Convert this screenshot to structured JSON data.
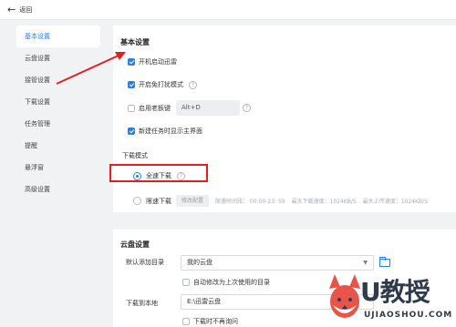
{
  "topbar": {
    "back_label": "返回"
  },
  "sidebar": {
    "items": [
      {
        "label": "基本设置",
        "active": true
      },
      {
        "label": "云盘设置",
        "active": false
      },
      {
        "label": "接管设置",
        "active": false
      },
      {
        "label": "下载设置",
        "active": false
      },
      {
        "label": "任务管理",
        "active": false
      },
      {
        "label": "提醒",
        "active": false
      },
      {
        "label": "悬浮窗",
        "active": false
      },
      {
        "label": "高级设置",
        "active": false
      }
    ]
  },
  "basic": {
    "title": "基本设置",
    "autostart": {
      "label": "开机启动迅雷",
      "checked": true
    },
    "no_disturb": {
      "label": "开启免打扰模式",
      "checked": true
    },
    "boss_key": {
      "label": "启用老板键",
      "checked": false,
      "hotkey": "Alt+D"
    },
    "show_main": {
      "label": "新建任务时显示主界面",
      "checked": true
    },
    "download_mode": {
      "title": "下载模式",
      "full_speed": {
        "label": "全速下载",
        "selected": true
      },
      "limited": {
        "label": "限速下载",
        "selected": false,
        "edit_label": "修改配置",
        "time_range": "限速时间段： 00:00-23: 59",
        "max_download": "最大下载速度：1024KB/S",
        "max_upload": "最大上传速度：1024KB/S"
      }
    }
  },
  "cloud": {
    "title": "云盘设置",
    "default_dir_label": "默认添加目录",
    "default_dir_value": "我的云盘",
    "auto_modify": {
      "label": "自动修改为上次使用的目录",
      "checked": false
    },
    "local_label": "下载到本地",
    "local_value": "E:\\迅雷云盘",
    "no_ask": {
      "label": "下载时不再询问",
      "checked": false
    }
  },
  "watermark": {
    "brand": "U教授",
    "url": "UJIAOSHOU.COM"
  },
  "colors": {
    "accent": "#2b7de9",
    "highlight": "#e02020"
  }
}
